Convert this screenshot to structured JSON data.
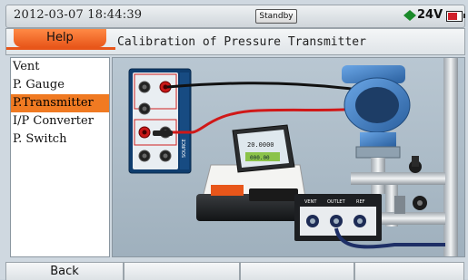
{
  "status": {
    "datetime": "2012-03-07 18:44:39",
    "state": "Standby",
    "voltage": "24V",
    "battery_level": 0.7
  },
  "titlebar": {
    "menu_tab": "Help",
    "title": "Calibration of Pressure Transmitter"
  },
  "menu": {
    "items": [
      {
        "label": "Vent"
      },
      {
        "label": "P. Gauge"
      },
      {
        "label": "P.Transmitter"
      },
      {
        "label": "I/P Converter"
      },
      {
        "label": "P. Switch"
      }
    ],
    "selected_index": 2
  },
  "illustration": {
    "port_labels": [
      "VENT",
      "OUTLET",
      "REF"
    ],
    "readout_value": "20.0000",
    "readout_secondary": "000.00",
    "module_label": "SOURCE",
    "colors": {
      "wire_black": "#111111",
      "wire_red": "#d01818",
      "transmitter_blue": "#3a78c2",
      "accent": "#e8561a"
    }
  },
  "footer": {
    "buttons": [
      {
        "label": "Back"
      },
      {
        "label": ""
      },
      {
        "label": ""
      },
      {
        "label": ""
      }
    ]
  }
}
